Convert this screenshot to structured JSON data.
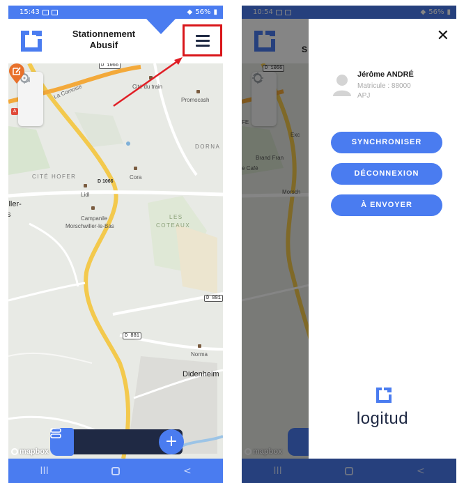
{
  "left_screen": {
    "status": {
      "time": "15:43",
      "battery": "56%"
    },
    "header": {
      "title_line1": "Stationnement",
      "title_line2": "Abusif"
    },
    "map_labels": {
      "la_comoise": "La Comoise",
      "city_du_train": "Cité du train",
      "promocash": "Promocash",
      "dorna": "DORNA",
      "cite_hofer": "CITÉ HOFER",
      "d1066_a": "D 1066",
      "cora": "Cora",
      "lidl": "Lidl",
      "iller": "iller-",
      "iller_s": "s",
      "campanile": "Campanile",
      "morschwiller": "Morschwiller-le-Bas",
      "les": "LES",
      "coteaux": "COTEAUX",
      "d881_a": "D 881",
      "d881_b": "D 881",
      "norma": "Norma",
      "didenheim": "Didenheim",
      "badge_top": "D 1066",
      "a_badge": "A"
    },
    "mapbox_label": "mapbox",
    "nav": {
      "recent": "III",
      "back": "<"
    }
  },
  "right_screen": {
    "status": {
      "time": "10:54",
      "battery": "56%"
    },
    "background_label": "S",
    "background_labels": {
      "d1066": "D 1066",
      "brand_fran": "Brand Fran",
      "e_cafe": "e Café",
      "morsch": "Morsch",
      "exc": "Exc",
      "fe": "FE"
    },
    "close_glyph": "✕",
    "user": {
      "name": "Jérôme ANDRÉ",
      "matricule": "Matricule : 88000",
      "unit": "APJ"
    },
    "buttons": {
      "sync": "SYNCHRONISER",
      "logout": "DÉCONNEXION",
      "send": "À ENVOYER"
    },
    "brand": "logitud",
    "mapbox_label": "mapbox",
    "nav": {
      "recent": "III",
      "back": "<"
    }
  },
  "colors": {
    "accent": "#4a7cf0",
    "dark": "#1f2944",
    "marker": "#e8712b",
    "highlight": "#d9161a"
  }
}
